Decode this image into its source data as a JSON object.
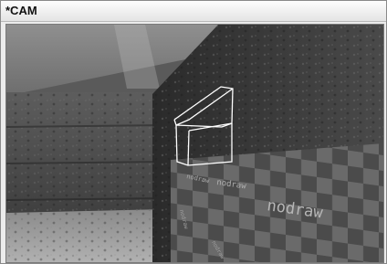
{
  "window": {
    "title": "*CAM"
  },
  "viewport": {
    "label_texts": [
      "nodraw",
      "nodraw",
      "nodraw",
      "nodraw",
      "nodraw"
    ]
  },
  "colors": {
    "title_bar_top": "#fdfdfd",
    "title_bar_bottom": "#e4e4e4",
    "wireframe": "#ffffff"
  }
}
